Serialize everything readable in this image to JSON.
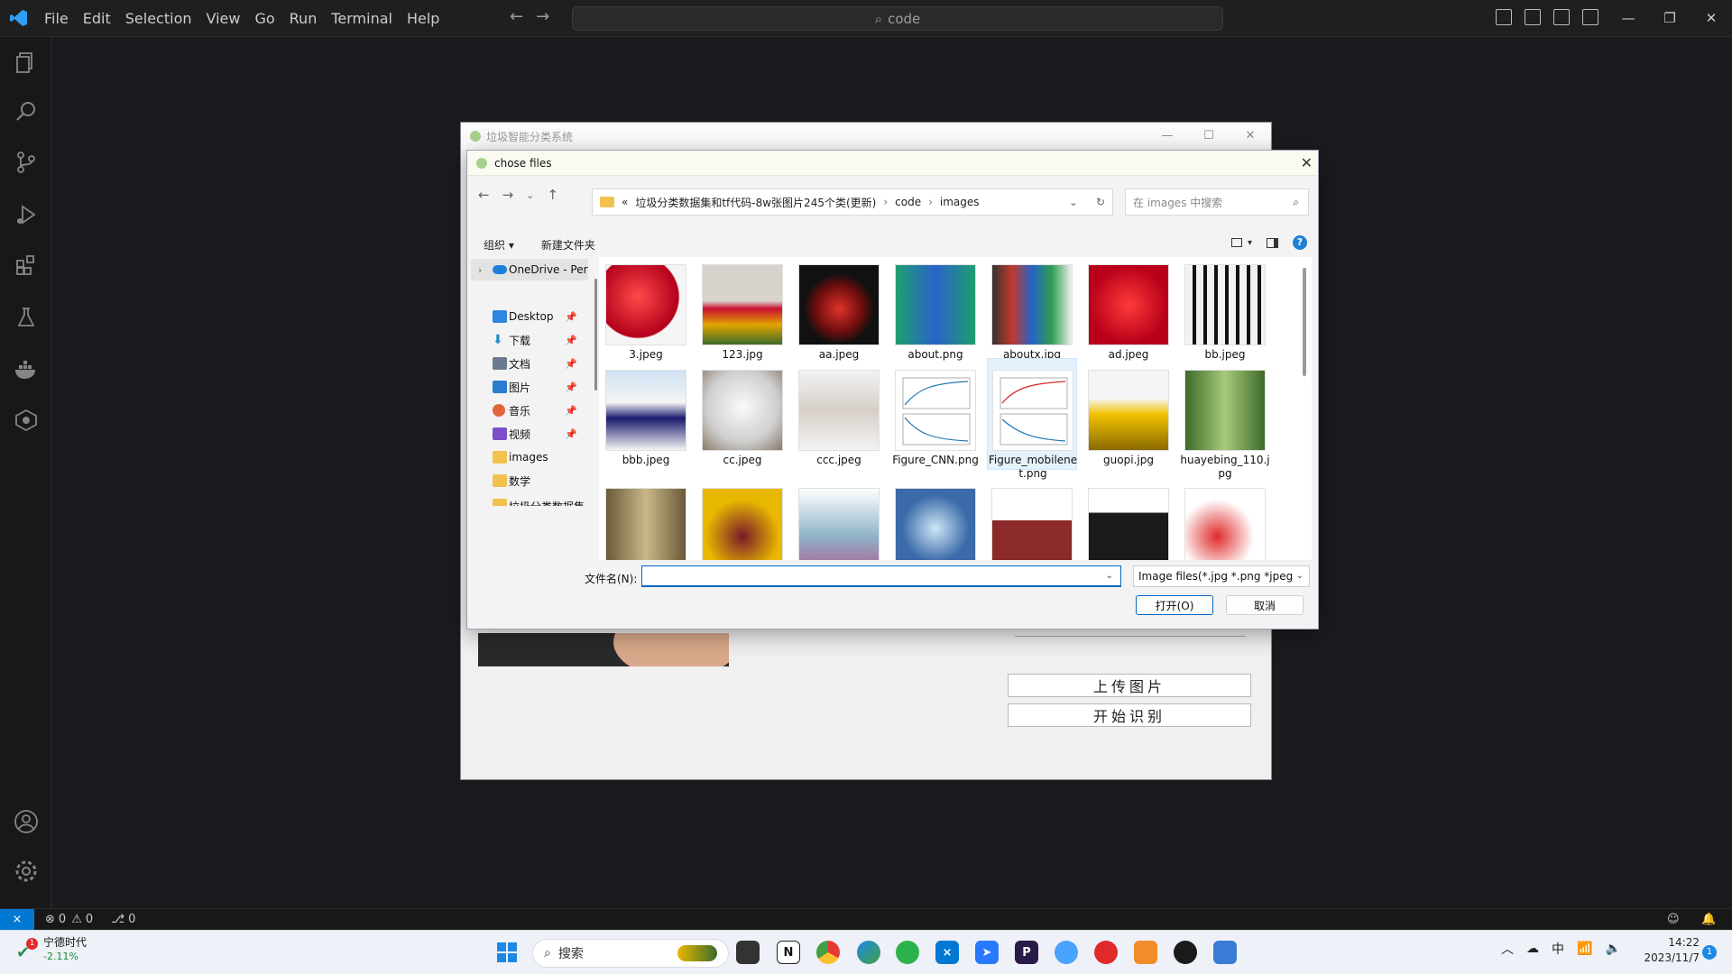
{
  "vscode": {
    "menu": [
      "File",
      "Edit",
      "Selection",
      "View",
      "Go",
      "Run",
      "Terminal",
      "Help"
    ],
    "search_text": "code",
    "status": {
      "errors": "0",
      "warnings": "0",
      "ports": "0"
    }
  },
  "app_window": {
    "title": "垃圾智能分类系统",
    "upload_button": "上传图片",
    "recognize_button": "开始识别"
  },
  "dialog": {
    "title": "chose files",
    "breadcrumb": [
      "«",
      "垃圾分类数据集和tf代码-8w张图片245个类(更新)",
      "code",
      "images"
    ],
    "search_placeholder": "在 images 中搜索",
    "organize": "组织 ▾",
    "new_folder": "新建文件夹",
    "nav_items": [
      {
        "label": "OneDrive - Per",
        "color": "#1e7fd8"
      },
      {
        "label": "Desktop",
        "color": "#2e86de"
      },
      {
        "label": "下载",
        "color": "#1e90c8"
      },
      {
        "label": "文档",
        "color": "#6b7a8f"
      },
      {
        "label": "图片",
        "color": "#2b7bd0"
      },
      {
        "label": "音乐",
        "color": "#e2653a"
      },
      {
        "label": "视频",
        "color": "#7a4fc9"
      },
      {
        "label": "images",
        "color": "#f2c14e"
      },
      {
        "label": "数学",
        "color": "#f2c14e"
      },
      {
        "label": "垃圾分类数据集",
        "color": "#f2c14e"
      }
    ],
    "files": [
      {
        "name": "3.jpeg",
        "bg": "radial-gradient(circle at 40% 40%, #ff4a4a, #b3001b 60%, #f5f5f5 62%)"
      },
      {
        "name": "123.jpg",
        "bg": "linear-gradient(#d9d3cd 0%, #d9d3cd 45%, #c8102e 55%, #e2a400 75%, #3d6b2a 100%)"
      },
      {
        "name": "aa.jpeg",
        "bg": "radial-gradient(circle at 50% 55%, #e0322a, #6b0d0d 40%, #111 60%)"
      },
      {
        "name": "about.png",
        "bg": "linear-gradient(90deg, #1f9e6f 0%, #2a63c9 50%, #1f9e6f 100%)"
      },
      {
        "name": "aboutx.jpg",
        "bg": "linear-gradient(90deg, #333 0%, #c0392b 25%, #2563c9 50%, #2f9e4f 75%, #eee 100%)"
      },
      {
        "name": "ad.jpeg",
        "bg": "radial-gradient(circle at 50% 50%, #ff3a3a, #b8001a 70%)"
      },
      {
        "name": "bb.jpeg",
        "bg": "repeating-linear-gradient(90deg, #f2f2f2 0 8px, #111 8px 12px)"
      },
      {
        "name": "bbb.jpeg",
        "bg": "linear-gradient(#cfe0f2 0%, #f5f5f5 40%, #1a1a6e 60%, #f5f5f5 100%)"
      },
      {
        "name": "cc.jpeg",
        "bg": "radial-gradient(circle at 50% 45%, #fafafa, #cfcfcf 60%, #8a7a6a 100%)"
      },
      {
        "name": "ccc.jpeg",
        "bg": "linear-gradient(#f3f3f3 0%, #d6cfc8 50%, #f3f3f3 100%)"
      },
      {
        "name": "Figure_CNN.png",
        "bg": "linear-gradient(#ffffff, #ffffff)"
      },
      {
        "name": "Figure_mobilenet.png",
        "bg": "linear-gradient(#ffffff, #ffffff)"
      },
      {
        "name": "guopi.jpg",
        "bg": "linear-gradient(#f5f5f5 0%, #f5f5f5 35%, #f2c200 55%, #8a6a00 100%)"
      },
      {
        "name": "huayebing_110.jpg",
        "bg": "linear-gradient(90deg, #3d6b2a, #a8c97a, #3d6b2a)"
      },
      {
        "name": "",
        "bg": "linear-gradient(90deg, #6b5a3a, #c9b88a, #6b5a3a)"
      },
      {
        "name": "",
        "bg": "radial-gradient(circle at 50% 60%, #7a1a2a, #e8b800 60%)"
      },
      {
        "name": "",
        "bg": "linear-gradient(#ffffff 0%, #8fb3c9 60%, #a86a9a 100%)"
      },
      {
        "name": "",
        "bg": "radial-gradient(circle at 50% 50%, #cfe6f5, #3a6aa8 60%)"
      },
      {
        "name": "",
        "bg": "linear-gradient(#ffffff 0%, #ffffff 40%, #8a2a2a 40%)"
      },
      {
        "name": "",
        "bg": "linear-gradient(#ffffff 0%, #ffffff 30%, #1a1a1a 30%)"
      },
      {
        "name": "",
        "bg": "radial-gradient(circle at 40% 60%, #e02a2a, #ffffff 55%)"
      }
    ],
    "filename_label": "文件名(N):",
    "filename_value": "",
    "filetype": "Image files(*.jpg *.png *jpeg",
    "open_button": "打开(O)",
    "cancel_button": "取消"
  },
  "taskbar": {
    "weather_title": "宁德时代",
    "weather_value": "-2.11%",
    "search_label": "搜索",
    "tray_lang": "中",
    "clock_time": "14:22",
    "clock_date": "2023/11/7",
    "notification_count": "1",
    "weather_badge": "1"
  }
}
